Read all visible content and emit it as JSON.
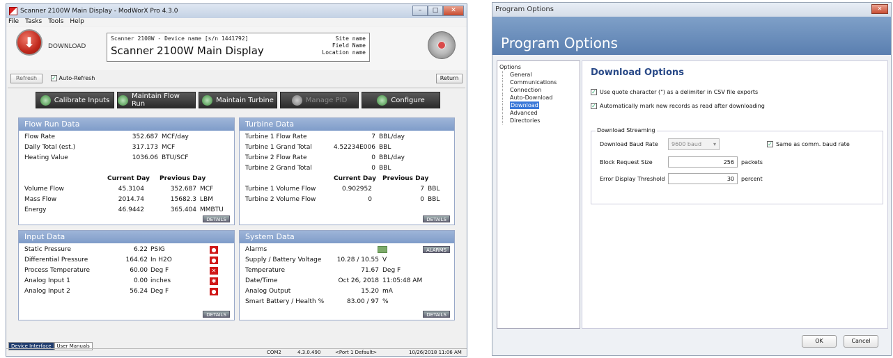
{
  "main_window": {
    "title": "Scanner 2100W Main Display - ModWorX Pro 4.3.0",
    "menu": [
      "File",
      "Tasks",
      "Tools",
      "Help"
    ],
    "download_label": "DOWNLOAD",
    "device_line": "Scanner 2100W - Device name [s/n 1441792]",
    "display_title": "Scanner 2100W Main Display",
    "site_name": "Site name",
    "field_name": "Field Name",
    "location_name": "Location name",
    "refresh_label": "Refresh",
    "auto_refresh_label": "Auto-Refresh",
    "auto_refresh_checked": true,
    "return_label": "Return",
    "actions": [
      {
        "label": "Calibrate Inputs",
        "enabled": true
      },
      {
        "label": "Maintain Flow Run",
        "enabled": true
      },
      {
        "label": "Maintain Turbine",
        "enabled": true
      },
      {
        "label": "Manage PID",
        "enabled": false
      },
      {
        "label": "Configure",
        "enabled": true
      }
    ],
    "flow_run": {
      "title": "Flow Run Data",
      "rows": [
        {
          "label": "Flow Rate",
          "value": "352.687",
          "unit": "MCF/day"
        },
        {
          "label": "Daily Total (est.)",
          "value": "317.173",
          "unit": "MCF"
        },
        {
          "label": "Heating Value",
          "value": "1036.06",
          "unit": "BTU/SCF"
        }
      ],
      "col_current": "Current Day",
      "col_previous": "Previous Day",
      "table": [
        {
          "label": "Volume Flow",
          "current": "45.3104",
          "previous": "352.687",
          "unit": "MCF"
        },
        {
          "label": "Mass Flow",
          "current": "2014.74",
          "previous": "15682.3",
          "unit": "LBM"
        },
        {
          "label": "Energy",
          "current": "46.9442",
          "previous": "365.404",
          "unit": "MMBTU"
        }
      ],
      "details": "DETAILS"
    },
    "turbine": {
      "title": "Turbine Data",
      "rows": [
        {
          "label": "Turbine 1 Flow Rate",
          "value": "7",
          "unit": "BBL/day"
        },
        {
          "label": "Turbine 1 Grand Total",
          "value": "4.52234E006",
          "unit": "BBL"
        },
        {
          "label": "Turbine 2 Flow Rate",
          "value": "0",
          "unit": "BBL/day"
        },
        {
          "label": "Turbine 2 Grand Total",
          "value": "0",
          "unit": "BBL"
        }
      ],
      "col_current": "Current Day",
      "col_previous": "Previous Day",
      "table": [
        {
          "label": "Turbine 1 Volume Flow",
          "current": "0.902952",
          "previous": "7",
          "unit": "BBL"
        },
        {
          "label": "Turbine 2 Volume Flow",
          "current": "0",
          "previous": "0",
          "unit": "BBL"
        }
      ],
      "details": "DETAILS"
    },
    "input": {
      "title": "Input Data",
      "rows": [
        {
          "label": "Static Pressure",
          "value": "6.22",
          "unit": "PSIG",
          "icon": "lock-icon",
          "glyph": "🔒"
        },
        {
          "label": "Differential Pressure",
          "value": "164.62",
          "unit": "In H2O",
          "icon": "lock-icon",
          "glyph": "🔒"
        },
        {
          "label": "Process Temperature",
          "value": "60.00",
          "unit": "Deg F",
          "icon": "x-icon",
          "glyph": "✕"
        },
        {
          "label": "Analog Input 1",
          "value": "0.00",
          "unit": "inches",
          "icon": "gear-icon",
          "glyph": "✱"
        },
        {
          "label": "Analog Input 2",
          "value": "56.24",
          "unit": "Deg F",
          "icon": "lock-icon",
          "glyph": "🔒"
        }
      ],
      "details": "DETAILS"
    },
    "system": {
      "title": "System Data",
      "rows": [
        {
          "label": "Alarms",
          "value": "",
          "unit": ""
        },
        {
          "label": "Supply / Battery Voltage",
          "value": "10.28 / 10.55",
          "unit": "V"
        },
        {
          "label": "Temperature",
          "value": "71.67",
          "unit": "Deg F"
        },
        {
          "label": "Date/Time",
          "value": "Oct 26, 2018",
          "unit": "11:05:48 AM"
        },
        {
          "label": "Analog Output",
          "value": "15.20",
          "unit": "mA"
        },
        {
          "label": "Smart Battery / Health %",
          "value": "83.00 / 97",
          "unit": "%"
        }
      ],
      "alarms_btn": "ALARMS",
      "details": "DETAILS"
    },
    "tabs": [
      "Device Interface",
      "User Manuals"
    ],
    "status": {
      "port": "COM2",
      "version": "4.3.0.490",
      "port_default": "<Port 1 Default>",
      "datetime": "10/26/2018 11:06 AM"
    }
  },
  "options_window": {
    "title": "Program Options",
    "header": "Program Options",
    "tree_root": "Options",
    "tree_items": [
      "General",
      "Communications",
      "Connection",
      "Auto-Download",
      "Download",
      "Advanced",
      "Directories"
    ],
    "selected": "Download",
    "heading": "Download Options",
    "opt1": "Use quote character (\") as a delimiter in CSV file exports",
    "opt2": "Automatically mark new records as read after downloading",
    "group_title": "Download Streaming",
    "baud_label": "Download Baud Rate",
    "baud_value": "9600 baud",
    "same_as_label": "Same as comm. baud rate",
    "block_label": "Block Request Size",
    "block_value": "256",
    "block_unit": "packets",
    "err_label": "Error Display Threshold",
    "err_value": "30",
    "err_unit": "percent",
    "ok": "OK",
    "cancel": "Cancel"
  }
}
